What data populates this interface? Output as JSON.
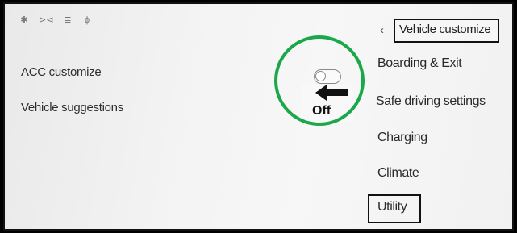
{
  "status_bar": {
    "icons": [
      "bluetooth-icon",
      "wifi-icon",
      "menu-icon",
      "signal-icon"
    ],
    "glyphs": [
      "✱",
      "⊳⊲",
      "≣",
      "ɸ"
    ]
  },
  "settings": {
    "acc_customize": "ACC customize",
    "vehicle_suggestions": "Vehicle suggestions",
    "toggle_state": "off"
  },
  "annotation": {
    "off_label": "Off",
    "circle_color": "#1aa84b"
  },
  "menu": {
    "back_glyph": "‹",
    "header": "Vehicle customize",
    "items": [
      "Boarding & Exit",
      "Safe driving settings",
      "Charging",
      "Climate",
      "Utility"
    ]
  }
}
